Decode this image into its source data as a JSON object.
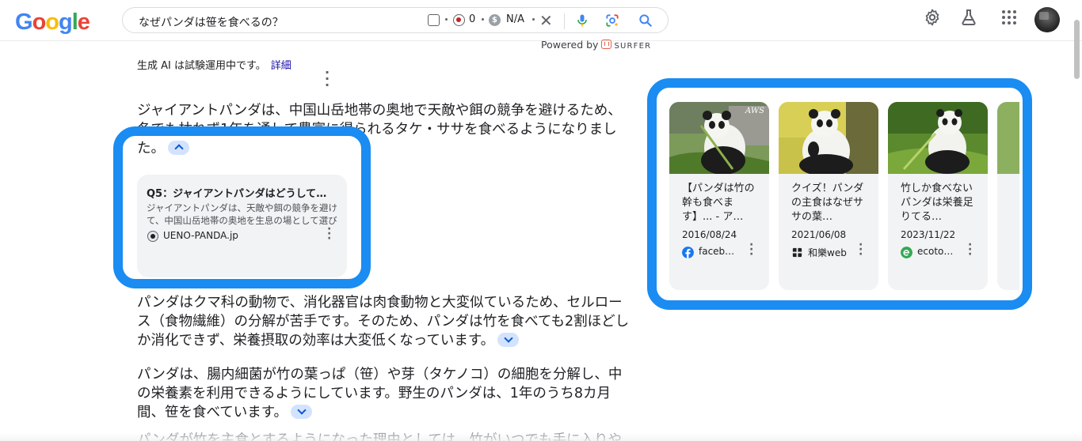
{
  "header": {
    "logo_letters": [
      "G",
      "o",
      "o",
      "g",
      "l",
      "e"
    ],
    "logo_colors": [
      "#4285f4",
      "#ea4335",
      "#fbbc05",
      "#4285f4",
      "#34a853",
      "#ea4335"
    ],
    "search_query": "なぜパンダは笹を食べるの？",
    "extension": {
      "count": "0",
      "value": "N/A",
      "separator": "·"
    }
  },
  "powered_by": {
    "label": "Powered by",
    "brand": "SURFER"
  },
  "ai_overview": {
    "notice": "生成 AI は試験運用中です。",
    "detail_link": "詳細",
    "paragraphs": [
      "ジャイアントパンダは、中国山岳地帯の奥地で天敵や餌の競争を避けるため、冬でも枯れず1年を通して豊富に得られるタケ・ササを食べるようになりました。",
      "パンダはクマ科の動物で、消化器官は肉食動物と大変似ているため、セルロース（食物繊維）の分解が苦手です。そのため、パンダは竹を食べても2割ほどしか消化できず、栄養摂取の効率は大変低くなっています。",
      "パンダは、腸内細菌が竹の葉っぱ（笹）や芽（タケノコ）の細胞を分解し、中の栄養素を利用できるようにしています。野生のパンダは、1年のうち8カ月間、笹を食べています。",
      "パンダが竹を主食とするようになった理由としては、竹がいつでも手に入りやすいことが挙げられます。"
    ],
    "source_card": {
      "title": "Q5：ジャイアントパンダはどうしてササを食べるの？",
      "snippet": "ジャイアントパンダは、天敵や餌の競争を避けて、中国山岳地帯の奥地を生息の場として選びました。",
      "site": "UENO-PANDA.jp"
    }
  },
  "result_cards": [
    {
      "title": "【パンダは竹の幹も食べます】... - ア…",
      "date": "2016/08/24",
      "site": "faceb…",
      "favicon_color": "#1877f2",
      "watermark": "AWS"
    },
    {
      "title": "クイズ！パンダの主食はなぜササの葉…",
      "date": "2021/06/08",
      "site": "和樂web",
      "favicon_color": "#202124"
    },
    {
      "title": "竹しか食べないパンダは栄養足りてる…",
      "date": "2023/11/22",
      "site": "ecoto…",
      "favicon_color": "#34a853"
    }
  ],
  "colors": {
    "highlight": "#1a8cf2",
    "link": "#1a0dab",
    "chip": "#d3e3fd"
  }
}
